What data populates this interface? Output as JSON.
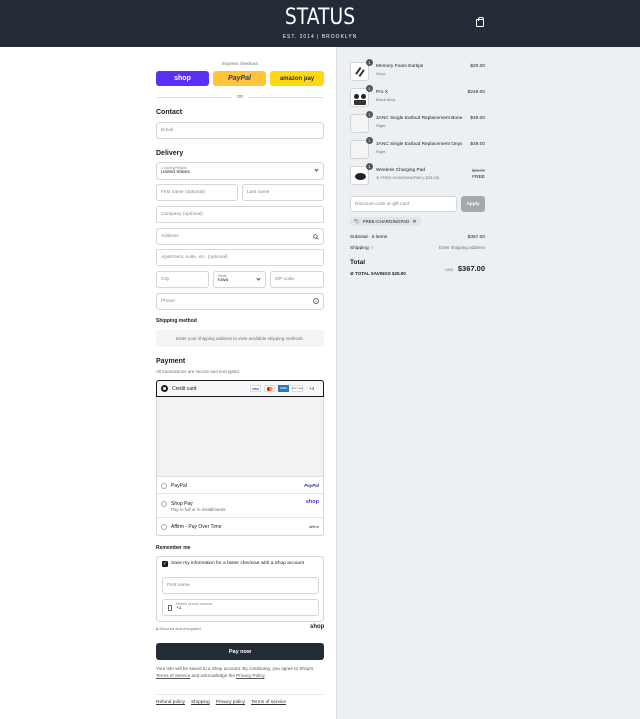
{
  "header": {
    "logo": "STATUS",
    "tagline": "EST. 2014 | BROOKLYN"
  },
  "express": {
    "title": "Express checkout",
    "shop": "shop",
    "paypal": "PayPal",
    "amazon": "amazon pay",
    "or": "OR"
  },
  "contact": {
    "title": "Contact",
    "email_placeholder": "Email"
  },
  "delivery": {
    "title": "Delivery",
    "country_label": "Country/Region",
    "country_value": "United States",
    "first_name": "First name (optional)",
    "last_name": "Last name",
    "company": "Company (optional)",
    "address": "Address",
    "apartment": "Apartment, suite, etc. (optional)",
    "city": "City",
    "state_label": "State",
    "state_value": "Iowa",
    "zip": "ZIP code",
    "phone": "Phone"
  },
  "shipping": {
    "title": "Shipping method",
    "message": "Enter your shipping address to view available shipping methods."
  },
  "payment": {
    "title": "Payment",
    "subtitle": "All transactions are secure and encrypted.",
    "credit": "Credit card",
    "more": "+4",
    "paypal": "PayPal",
    "paypal_logo": "PayPal",
    "shoppay": "Shop Pay",
    "shoppay_sub": "Pay in full or in installments",
    "shoppay_logo": "shop",
    "affirm": "Affirm - Pay Over Time",
    "affirm_logo": "affirm",
    "cards": [
      "VISA",
      "MC",
      "AMEX",
      "DISCOVER"
    ]
  },
  "remember": {
    "title": "Remember me",
    "checkbox": "Save my information for a faster checkout with a Shop account",
    "first_name": "First name",
    "mobile_label": "Mobile phone number",
    "mobile_value": "+1",
    "secure": "Secured and encrypted",
    "shop": "shop"
  },
  "paynow": "Pay now",
  "consent": {
    "text1": "Your info will be saved to a Shop account. By continuing, you agree to Shop's ",
    "terms": "Terms of Service",
    "text2": " and acknowledge the ",
    "privacy": "Privacy Policy",
    "text3": "."
  },
  "footer": [
    "Refund policy",
    "Shipping",
    "Privacy policy",
    "Terms of service"
  ],
  "cart": {
    "items": [
      {
        "name": "Memory Foam Eartips",
        "variant": "Onyx",
        "price": "$20.00",
        "qty": "1"
      },
      {
        "name": "Pro X",
        "variant": "Black Alloy",
        "price": "$249.00",
        "qty": "1"
      },
      {
        "name": "3ANC Single Earbud Replacement Bone",
        "variant": "Right",
        "price": "$49.00",
        "qty": "1"
      },
      {
        "name": "3ANC Single Earbud Replacement Onyx",
        "variant": "Right",
        "price": "$49.00",
        "qty": "1"
      },
      {
        "name": "Wireless Charging Pad",
        "variant": "FREE-CHARGINGPAD (-$25.00)",
        "price_old": "$25.00",
        "price": "FREE",
        "qty": "1"
      }
    ],
    "discount_placeholder": "Discount code or gift card",
    "apply": "Apply",
    "code": "FREE-CHARGINGPAD",
    "subtotal_label": "Subtotal · 5 items",
    "subtotal": "$367.00",
    "shipping_label": "Shipping",
    "shipping_value": "Enter shipping address",
    "total_label": "Total",
    "currency": "USD",
    "total": "$367.00",
    "savings_label": "TOTAL SAVINGS",
    "savings": "$25.00"
  }
}
